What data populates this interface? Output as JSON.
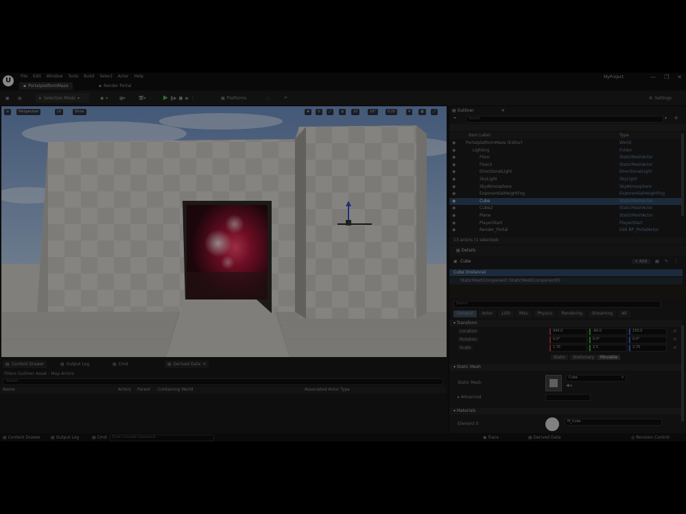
{
  "titlebar": {
    "menu": [
      "File",
      "Edit",
      "Window",
      "Tools",
      "Build",
      "Select",
      "Actor",
      "Help"
    ],
    "level_tab": "PortalplatformMaze",
    "source_tab": "Render Portal",
    "project": "MyProject",
    "winctl": [
      "—",
      "❐",
      "✕"
    ]
  },
  "toolbar": {
    "mode": "Selection Mode",
    "platforms": "Platforms",
    "settings": "Settings"
  },
  "viewport": {
    "view_label": "Perspective",
    "lit_label": "Lit",
    "show_label": "Show",
    "grid_value": "10",
    "angle_value": "10°",
    "scale_value": "0.25",
    "speed_value": "4"
  },
  "bottom": {
    "tabs": [
      "Content Drawer",
      "Output Log",
      "Cmd",
      "Derived Data"
    ],
    "filter_text": "Filters Outliner Asset - Map  Actors",
    "search_placeholder": "Search",
    "columns": [
      "Name",
      "Actors",
      "Parent",
      "Containing World",
      "Associated Actor Type"
    ]
  },
  "statusbar": {
    "content_drawer": "Content Drawer",
    "output_log": "Output Log",
    "cmd": "Cmd",
    "console_placeholder": "Enter Console Command",
    "trace": "Trace",
    "derived_data": "Derived Data",
    "revision": "Revision Control"
  },
  "outliner": {
    "tab": "Outliner",
    "search_placeholder": "Search",
    "header_label": "Item Label",
    "header_type": "Type",
    "rows": [
      {
        "label": "PortalplatformMaze (Editor)",
        "type": "World",
        "indent": 0
      },
      {
        "label": "Lighting",
        "type": "Folder",
        "indent": 1
      },
      {
        "label": "Floor",
        "type": "StaticMeshActor",
        "indent": 2
      },
      {
        "label": "Floor2",
        "type": "StaticMeshActor",
        "indent": 2
      },
      {
        "label": "DirectionalLight",
        "type": "DirectionalLight",
        "indent": 2
      },
      {
        "label": "SkyLight",
        "type": "SkyLight",
        "indent": 2
      },
      {
        "label": "SkyAtmosphere",
        "type": "SkyAtmosphere",
        "indent": 2
      },
      {
        "label": "ExponentialHeightFog",
        "type": "ExponentialHeightFog",
        "indent": 2
      },
      {
        "label": "Cube",
        "type": "StaticMeshActor",
        "indent": 2,
        "selected": true
      },
      {
        "label": "Cube2",
        "type": "StaticMeshActor",
        "indent": 2
      },
      {
        "label": "Plane",
        "type": "StaticMeshActor",
        "indent": 2
      },
      {
        "label": "PlayerStart",
        "type": "PlayerStart",
        "indent": 2
      },
      {
        "label": "Render_Portal",
        "type": "Edit BP_PortalActor",
        "indent": 2
      }
    ],
    "footer": "13 actors (1 selected)"
  },
  "details": {
    "tab": "Details",
    "actor_name": "Cube",
    "add_label": "+ Add",
    "root_component": "Cube (Instance)",
    "component": "StaticMeshComponent (StaticMeshComponent0)",
    "search_placeholder": "Search",
    "category_tabs": [
      "General",
      "Actor",
      "LOD",
      "Misc",
      "Physics",
      "Rendering",
      "Streaming",
      "All"
    ],
    "transform": {
      "header": "Transform",
      "labels": [
        "Location",
        "Rotation",
        "Scale"
      ],
      "location": [
        "940.0",
        "-60.0",
        "150.0"
      ],
      "rotation": [
        "0.0°",
        "0.0°",
        "0.0°"
      ],
      "scale": [
        "1.75",
        "2.5",
        "2.75"
      ],
      "mobility": [
        "Static",
        "Stationary",
        "Movable"
      ]
    },
    "static_mesh": {
      "header": "Static Mesh",
      "label": "Static Mesh",
      "value": "Cube"
    },
    "advanced_label": "Advanced",
    "materials": {
      "header": "Materials",
      "label": "Element 0",
      "value": "M_Cube"
    },
    "accent": "#e0a33a",
    "selection": "#2e4660"
  }
}
